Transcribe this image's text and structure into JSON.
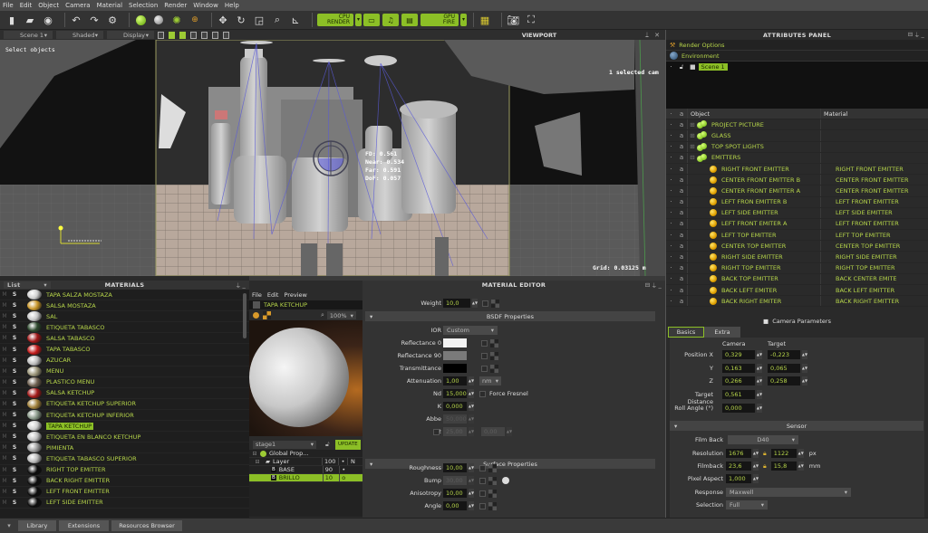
{
  "menu": [
    "File",
    "Edit",
    "Object",
    "Camera",
    "Material",
    "Selection",
    "Render",
    "Window",
    "Help"
  ],
  "toolbar": {
    "cpu_render_top": "CPU",
    "cpu_render_label": "RENDER",
    "gpu_fire_top": "GPU",
    "gpu_fire_label": "FIRE"
  },
  "viewport": {
    "title": "VIEWPORT",
    "scene_dropdown": "Scene 1",
    "shading_dropdown": "Shaded",
    "display_dropdown": "Display",
    "status_left": "Select objects",
    "status_right": "1 selected cam",
    "focus": {
      "fd": "FD: 0.561",
      "near": "Near: 0.534",
      "far": "Far: 0.591",
      "dof": "DoF: 0.057"
    },
    "grid": "Grid: 0.03125 m"
  },
  "attributes": {
    "title": "ATTRIBUTES PANEL",
    "render_options": "Render Options",
    "environment": "Environment",
    "scene": "Scene 1",
    "col_object": "Object",
    "col_material": "Material",
    "groups": [
      "PROJECT PICTURE",
      "GLASS",
      "TOP SPOT LIGHTS",
      "EMITTERS"
    ],
    "emitters": [
      {
        "object": "RIGHT FRONT EMITTER",
        "material": "RIGHT FRONT  EMITTER"
      },
      {
        "object": "CENTER FRONT EMITTER B",
        "material": "CENTER  FRONT  EMITTER"
      },
      {
        "object": "CENTER FRONT EMITTER A",
        "material": "CENTER  FRONT  EMITTER"
      },
      {
        "object": "LEFT FRON EMITTER B",
        "material": "LEFT FRONT  EMITTER"
      },
      {
        "object": "LEFT SIDE EMITTER",
        "material": "LEFT SIDE EMITTER"
      },
      {
        "object": "LEFT FRONT  EMITER A",
        "material": "LEFT FRONT  EMITTER"
      },
      {
        "object": "LEFT TOP EMITTER",
        "material": "LEFT TOP EMITTER"
      },
      {
        "object": "CENTER TOP EMITTER",
        "material": "CENTER TOP EMITTER"
      },
      {
        "object": " RIGHT SIDE EMITTER",
        "material": "RIGHT SIDE EMITTER"
      },
      {
        "object": "RIGHT TOP EMITTER",
        "material": "RIGHT TOP EMITTER"
      },
      {
        "object": "BACK TOP EMITTER",
        "material": "BACK CENTER EMITE"
      },
      {
        "object": "BACK LEFT EMITER",
        "material": "BACK LEFT  EMITTER"
      },
      {
        "object": "BACK RIGHT EMITER",
        "material": "BACK RIGHT EMITTER"
      }
    ],
    "camera_params": "Camera Parameters",
    "tabs": [
      "Basics",
      "Extra"
    ],
    "col_camera": "Camera",
    "col_target": "Target",
    "position_x_label": "Position X",
    "y_label": "Y",
    "z_label": "Z",
    "cam_x": "0,329",
    "cam_y": "0,163",
    "cam_z": "0,266",
    "tgt_x": "-0,223",
    "tgt_y": "0,065",
    "tgt_z": "0,258",
    "target_distance_label": "Target Distance",
    "target_distance": "0,561",
    "roll_label": "Roll Angle (°)",
    "roll": "0,000",
    "sensor": "Sensor",
    "film_back_label": "Film Back",
    "film_back": "D40",
    "resolution_label": "Resolution",
    "res_w": "1676",
    "res_h": "1122",
    "res_unit": "px",
    "filmback_label": "Filmback",
    "fb_w": "23,6",
    "fb_h": "15,8",
    "fb_unit": "mm",
    "pixel_aspect_label": "Pixel Aspect",
    "pixel_aspect": "1,000",
    "response_label": "Response",
    "response": "Maxwell",
    "selection_label": "Selection",
    "selection": "Full"
  },
  "materials": {
    "title": "MATERIALS",
    "view": "List",
    "items": [
      {
        "name": "TAPA SALZA MOSTAZA",
        "color": "#cfcfcf"
      },
      {
        "name": "SALSA MOSTAZA",
        "color": "#c8962a"
      },
      {
        "name": "SAL",
        "color": "#c8c8c8"
      },
      {
        "name": "ETIQUETA TABASCO",
        "color": "#2e4a2e"
      },
      {
        "name": "SALSA TABASCO",
        "color": "#a01818"
      },
      {
        "name": "TAPA TABASCO",
        "color": "#c41c1c"
      },
      {
        "name": "AZUCAR",
        "color": "#bdbdbd"
      },
      {
        "name": "MENU",
        "color": "#9a9478"
      },
      {
        "name": "PLASTICO MENU",
        "color": "#6e6050"
      },
      {
        "name": "SALSA KETCHUP",
        "color": "#a31a1a"
      },
      {
        "name": "ETIQUETA KETCHUP SUPERIOR",
        "color": "#a0803a"
      },
      {
        "name": "ETIQUETA KETCHUP INFERIOR",
        "color": "#8a9a8a"
      },
      {
        "name": "TAPA KETCHUP",
        "color": "#d0d0d0",
        "selected": true
      },
      {
        "name": "ETIQUETA EN BLANCO KETCHUP",
        "color": "#c0c0c0"
      },
      {
        "name": "PIMIENTA",
        "color": "#9a9a9a"
      },
      {
        "name": "ETIQUETA TABASCO SUPERIOR",
        "color": "#bbbbbb"
      },
      {
        "name": "RIGHT TOP  EMITTER",
        "color": "#0c0c0c"
      },
      {
        "name": "BACK RIGHT EMITTER",
        "color": "#0c0c0c"
      },
      {
        "name": "LEFT FRONT EMITTER",
        "color": "#0c0c0c"
      },
      {
        "name": "LEFT SIDE EMITTER",
        "color": "#0c0c0c"
      }
    ]
  },
  "editor": {
    "title": "MATERIAL EDITOR",
    "menu": [
      "File",
      "Edit",
      "Preview"
    ],
    "material_name": "TAPA KETCHUP",
    "zoom": "100%",
    "stage": "stage1",
    "update": "UPDATE",
    "layers": [
      {
        "name": "Global Prop...",
        "value": "",
        "flag": "",
        "extra": ""
      },
      {
        "name": "Layer",
        "value": "100",
        "flag": "•",
        "extra": "N"
      },
      {
        "name": "BASE",
        "value": "90",
        "flag": "•",
        "extra": ""
      },
      {
        "name": "BRILLO",
        "value": "10",
        "flag": "o",
        "extra": "",
        "selected": true
      }
    ],
    "weight_label": "Weight",
    "weight": "10,0",
    "bsdf": "BSDF Properties",
    "ior_label": "IOR",
    "ior": "Custom",
    "refl0_label": "Reflectance 0",
    "refl0_color": "#f2f2f2",
    "refl90_label": "Reflectance 90",
    "refl90_color": "#7a7a7a",
    "trans_label": "Transmittance",
    "trans_color": "#000000",
    "atten_label": "Attenuation",
    "atten": "1,00",
    "atten_unit": "nm",
    "nd_label": "Nd",
    "nd": "15,000",
    "force_fresnel": "Force Fresnel",
    "k_label": "K",
    "k": "0,000",
    "abbe_label": "Abbe",
    "abbe": "50,000",
    "r2_label": "R2",
    "r2_a": "25,00",
    "r2_b": "0,00",
    "surface": "Surface Properties",
    "roughness_label": "Roughness",
    "roughness": "10,00",
    "bump_label": "Bump",
    "bump": "30,00",
    "aniso_label": "Anisotropy",
    "aniso": "10,00",
    "angle_label": "Angle",
    "angle": "0,00"
  },
  "bottom_tabs": [
    "Library",
    "Extensions",
    "Resources Browser"
  ]
}
